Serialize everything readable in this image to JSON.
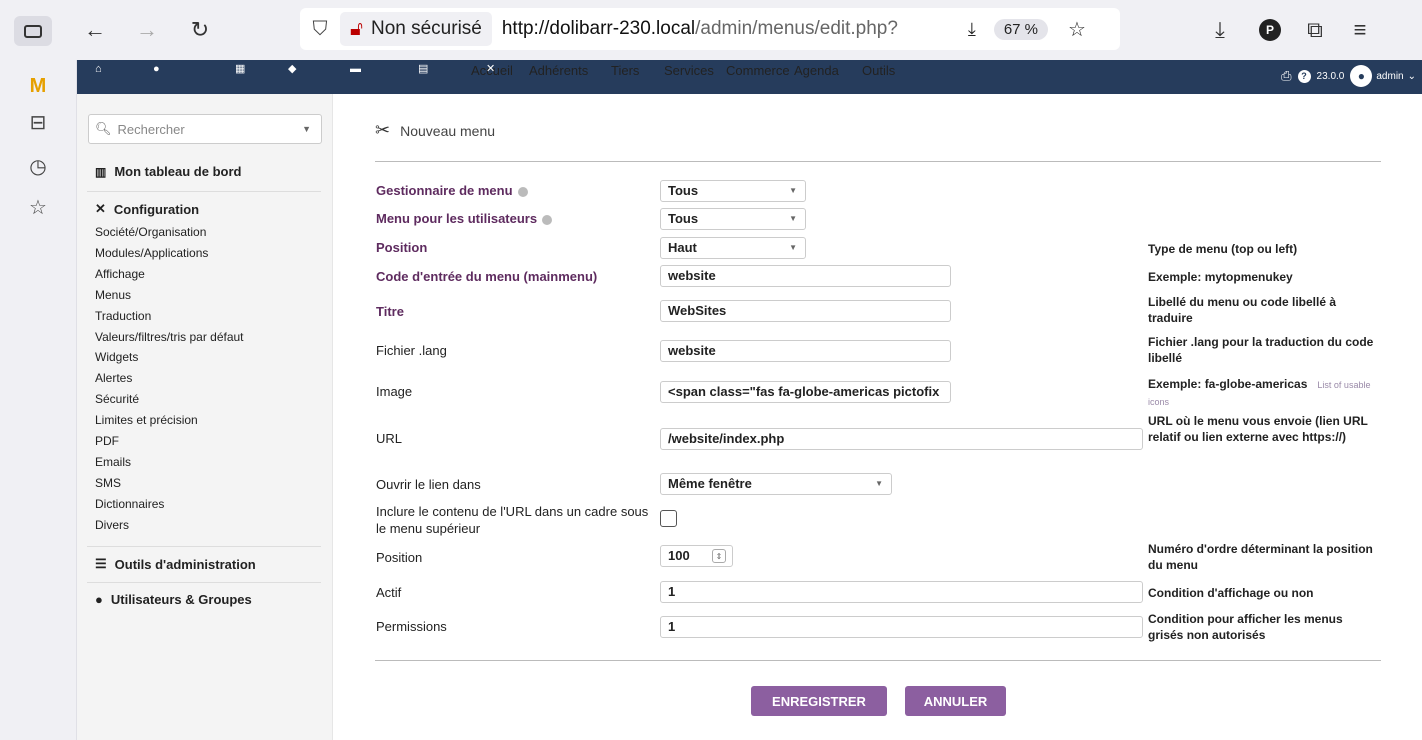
{
  "browser": {
    "security_label": "Non sécurisé",
    "url_host": "http://dolibarr-230.local",
    "url_path": "/admin/menus/edit.php?",
    "zoom": "67 %"
  },
  "topnav": {
    "items": [
      {
        "label": "Accueil"
      },
      {
        "label": "Adhérents"
      },
      {
        "label": "Tiers"
      },
      {
        "label": "Services"
      },
      {
        "label": "Commerce"
      },
      {
        "label": "Agenda"
      },
      {
        "label": "Outils"
      }
    ],
    "version": "23.0.0",
    "user": "admin"
  },
  "leftmenu": {
    "search_placeholder": "Rechercher",
    "dashboard": "Mon tableau de bord",
    "configuration": "Configuration",
    "config_items": [
      "Société/Organisation",
      "Modules/Applications",
      "Affichage",
      "Menus",
      "Traduction",
      "Valeurs/filtres/tris par défaut",
      "Widgets",
      "Alertes",
      "Sécurité",
      "Limites et précision",
      "PDF",
      "Emails",
      "SMS",
      "Dictionnaires",
      "Divers"
    ],
    "admin_tools": "Outils d'administration",
    "users_groups": "Utilisateurs & Groupes"
  },
  "page": {
    "title": "Nouveau menu"
  },
  "form": {
    "menu_handler": {
      "label": "Gestionnaire de menu",
      "value": "Tous"
    },
    "menu_for_users": {
      "label": "Menu pour les utilisateurs",
      "value": "Tous"
    },
    "position_type": {
      "label": "Position",
      "value": "Haut",
      "help": "Type de menu (top ou left)"
    },
    "mainmenu_code": {
      "label": "Code d'entrée du menu (mainmenu)",
      "value": "website",
      "help": "Exemple: mytopmenukey"
    },
    "title": {
      "label": "Titre",
      "value": "WebSites",
      "help": "Libellé du menu ou code libellé à traduire"
    },
    "lang_file": {
      "label": "Fichier .lang",
      "value": "website",
      "help": "Fichier .lang pour la traduction du code libellé"
    },
    "image": {
      "label": "Image",
      "value": "<span class=\"fas fa-globe-americas pictofix",
      "help": "Exemple: fa-globe-americas",
      "help_link": "List of usable icons"
    },
    "url": {
      "label": "URL",
      "value": "/website/index.php",
      "help": "URL où le menu vous envoie (lien URL relatif ou lien externe avec https://)"
    },
    "open_in": {
      "label": "Ouvrir le lien dans",
      "value": "Même fenêtre"
    },
    "include_iframe": {
      "label": "Inclure le contenu de l'URL dans un cadre sous le menu supérieur",
      "checked": false
    },
    "order": {
      "label": "Position",
      "value": "100",
      "help": "Numéro d'ordre déterminant la position du menu"
    },
    "active": {
      "label": "Actif",
      "value": "1",
      "help": "Condition d'affichage ou non"
    },
    "permissions": {
      "label": "Permissions",
      "value": "1",
      "help": "Condition pour afficher les menus grisés non autorisés"
    }
  },
  "buttons": {
    "save": "ENREGISTRER",
    "cancel": "ANNULER"
  }
}
